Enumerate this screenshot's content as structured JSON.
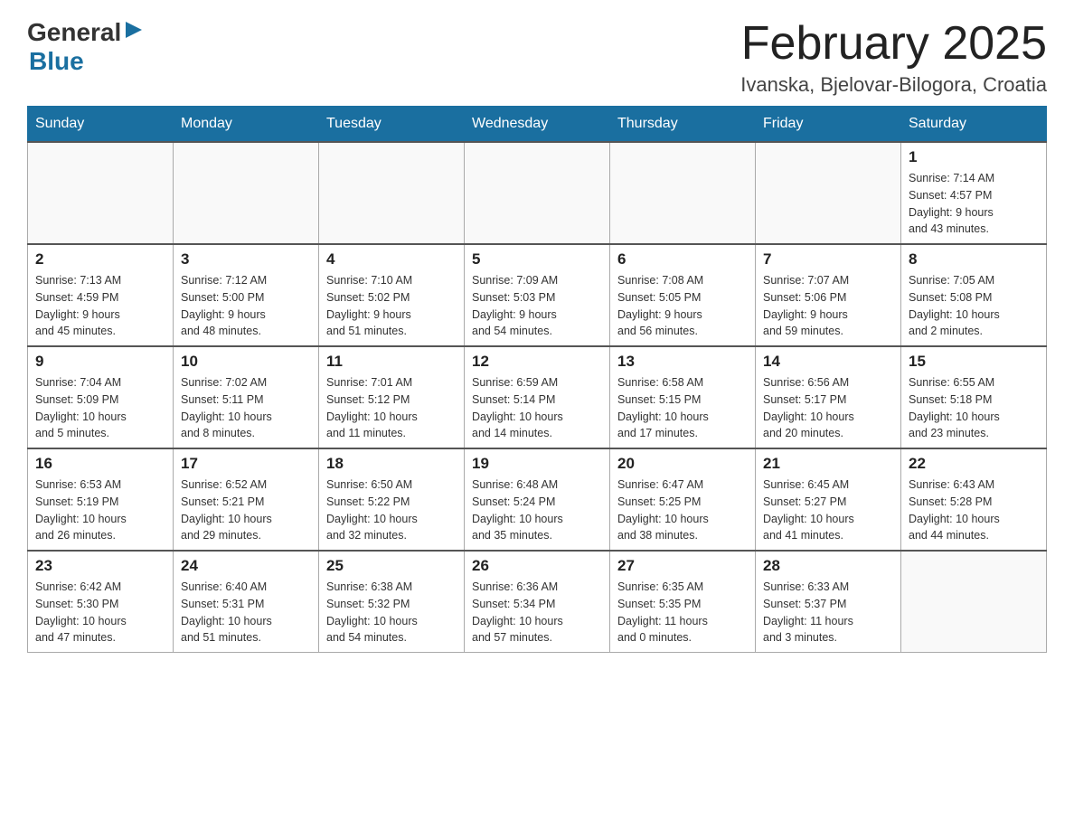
{
  "header": {
    "logo_general": "General",
    "logo_blue": "Blue",
    "month_title": "February 2025",
    "location": "Ivanska, Bjelovar-Bilogora, Croatia"
  },
  "weekdays": [
    "Sunday",
    "Monday",
    "Tuesday",
    "Wednesday",
    "Thursday",
    "Friday",
    "Saturday"
  ],
  "weeks": [
    [
      {
        "day": "",
        "info": ""
      },
      {
        "day": "",
        "info": ""
      },
      {
        "day": "",
        "info": ""
      },
      {
        "day": "",
        "info": ""
      },
      {
        "day": "",
        "info": ""
      },
      {
        "day": "",
        "info": ""
      },
      {
        "day": "1",
        "info": "Sunrise: 7:14 AM\nSunset: 4:57 PM\nDaylight: 9 hours\nand 43 minutes."
      }
    ],
    [
      {
        "day": "2",
        "info": "Sunrise: 7:13 AM\nSunset: 4:59 PM\nDaylight: 9 hours\nand 45 minutes."
      },
      {
        "day": "3",
        "info": "Sunrise: 7:12 AM\nSunset: 5:00 PM\nDaylight: 9 hours\nand 48 minutes."
      },
      {
        "day": "4",
        "info": "Sunrise: 7:10 AM\nSunset: 5:02 PM\nDaylight: 9 hours\nand 51 minutes."
      },
      {
        "day": "5",
        "info": "Sunrise: 7:09 AM\nSunset: 5:03 PM\nDaylight: 9 hours\nand 54 minutes."
      },
      {
        "day": "6",
        "info": "Sunrise: 7:08 AM\nSunset: 5:05 PM\nDaylight: 9 hours\nand 56 minutes."
      },
      {
        "day": "7",
        "info": "Sunrise: 7:07 AM\nSunset: 5:06 PM\nDaylight: 9 hours\nand 59 minutes."
      },
      {
        "day": "8",
        "info": "Sunrise: 7:05 AM\nSunset: 5:08 PM\nDaylight: 10 hours\nand 2 minutes."
      }
    ],
    [
      {
        "day": "9",
        "info": "Sunrise: 7:04 AM\nSunset: 5:09 PM\nDaylight: 10 hours\nand 5 minutes."
      },
      {
        "day": "10",
        "info": "Sunrise: 7:02 AM\nSunset: 5:11 PM\nDaylight: 10 hours\nand 8 minutes."
      },
      {
        "day": "11",
        "info": "Sunrise: 7:01 AM\nSunset: 5:12 PM\nDaylight: 10 hours\nand 11 minutes."
      },
      {
        "day": "12",
        "info": "Sunrise: 6:59 AM\nSunset: 5:14 PM\nDaylight: 10 hours\nand 14 minutes."
      },
      {
        "day": "13",
        "info": "Sunrise: 6:58 AM\nSunset: 5:15 PM\nDaylight: 10 hours\nand 17 minutes."
      },
      {
        "day": "14",
        "info": "Sunrise: 6:56 AM\nSunset: 5:17 PM\nDaylight: 10 hours\nand 20 minutes."
      },
      {
        "day": "15",
        "info": "Sunrise: 6:55 AM\nSunset: 5:18 PM\nDaylight: 10 hours\nand 23 minutes."
      }
    ],
    [
      {
        "day": "16",
        "info": "Sunrise: 6:53 AM\nSunset: 5:19 PM\nDaylight: 10 hours\nand 26 minutes."
      },
      {
        "day": "17",
        "info": "Sunrise: 6:52 AM\nSunset: 5:21 PM\nDaylight: 10 hours\nand 29 minutes."
      },
      {
        "day": "18",
        "info": "Sunrise: 6:50 AM\nSunset: 5:22 PM\nDaylight: 10 hours\nand 32 minutes."
      },
      {
        "day": "19",
        "info": "Sunrise: 6:48 AM\nSunset: 5:24 PM\nDaylight: 10 hours\nand 35 minutes."
      },
      {
        "day": "20",
        "info": "Sunrise: 6:47 AM\nSunset: 5:25 PM\nDaylight: 10 hours\nand 38 minutes."
      },
      {
        "day": "21",
        "info": "Sunrise: 6:45 AM\nSunset: 5:27 PM\nDaylight: 10 hours\nand 41 minutes."
      },
      {
        "day": "22",
        "info": "Sunrise: 6:43 AM\nSunset: 5:28 PM\nDaylight: 10 hours\nand 44 minutes."
      }
    ],
    [
      {
        "day": "23",
        "info": "Sunrise: 6:42 AM\nSunset: 5:30 PM\nDaylight: 10 hours\nand 47 minutes."
      },
      {
        "day": "24",
        "info": "Sunrise: 6:40 AM\nSunset: 5:31 PM\nDaylight: 10 hours\nand 51 minutes."
      },
      {
        "day": "25",
        "info": "Sunrise: 6:38 AM\nSunset: 5:32 PM\nDaylight: 10 hours\nand 54 minutes."
      },
      {
        "day": "26",
        "info": "Sunrise: 6:36 AM\nSunset: 5:34 PM\nDaylight: 10 hours\nand 57 minutes."
      },
      {
        "day": "27",
        "info": "Sunrise: 6:35 AM\nSunset: 5:35 PM\nDaylight: 11 hours\nand 0 minutes."
      },
      {
        "day": "28",
        "info": "Sunrise: 6:33 AM\nSunset: 5:37 PM\nDaylight: 11 hours\nand 3 minutes."
      },
      {
        "day": "",
        "info": ""
      }
    ]
  ]
}
